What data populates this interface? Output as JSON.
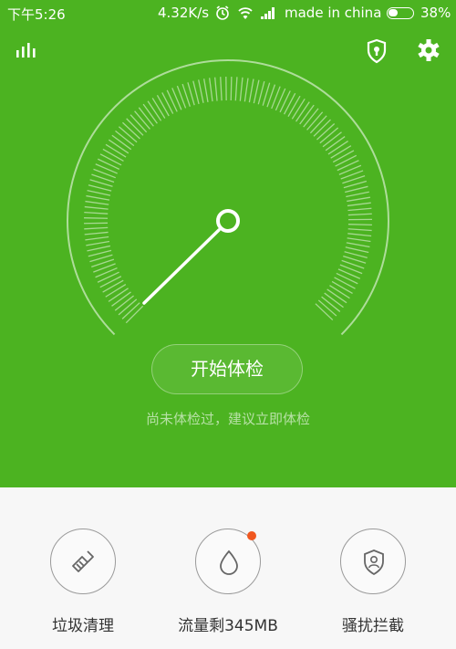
{
  "status_bar": {
    "time": "下午5:26",
    "speed": "4.32K/s",
    "carrier": "made in china",
    "battery": "38%",
    "battery_level": 0.38
  },
  "header": {
    "stats_icon": "bar-chart-icon",
    "shield_icon": "shield-lock-icon",
    "settings_icon": "gear-icon"
  },
  "gauge": {
    "needle_icon": "gauge-needle"
  },
  "main": {
    "check_button": "开始体检",
    "hint": "尚未体检过，建议立即体检"
  },
  "tools": [
    {
      "label": "垃圾清理",
      "icon": "broom-icon"
    },
    {
      "label": "流量剩345MB",
      "icon": "water-drop-icon",
      "badge": true
    },
    {
      "label": "骚扰拦截",
      "icon": "shield-user-icon"
    }
  ],
  "colors": {
    "primary": "#4cb321",
    "badge": "#f0571f"
  }
}
